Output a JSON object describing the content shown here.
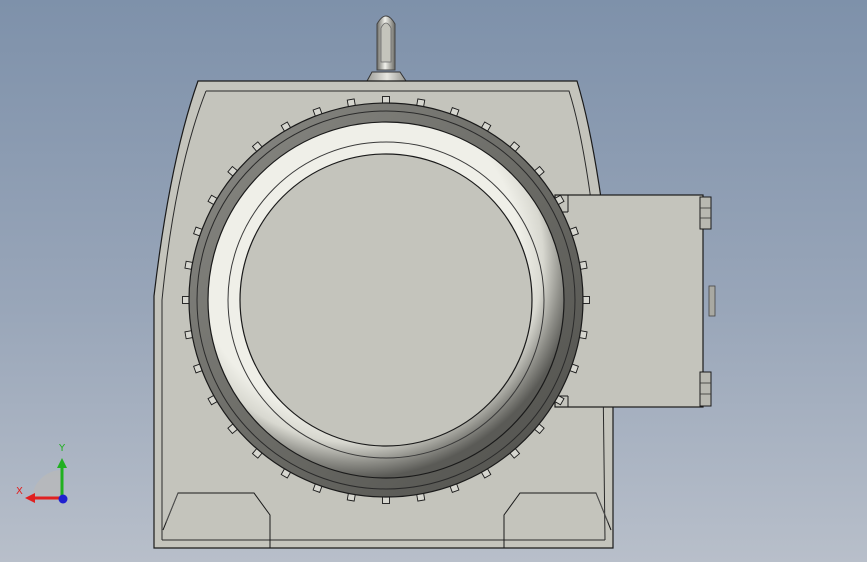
{
  "viewport": {
    "background_top": "#7e91aa",
    "background_bottom": "#b8bfca"
  },
  "model": {
    "body_color": "#c4c4bc",
    "edge_color": "#1a1a1a",
    "ring_dark": "#5e5e5a",
    "ring_light": "#f4f4ee",
    "component": "gear-reducer-housing"
  },
  "triad": {
    "x_label": "X",
    "y_label": "Y",
    "x_color": "#e02020",
    "y_color": "#20b020",
    "z_color": "#2020d0"
  }
}
